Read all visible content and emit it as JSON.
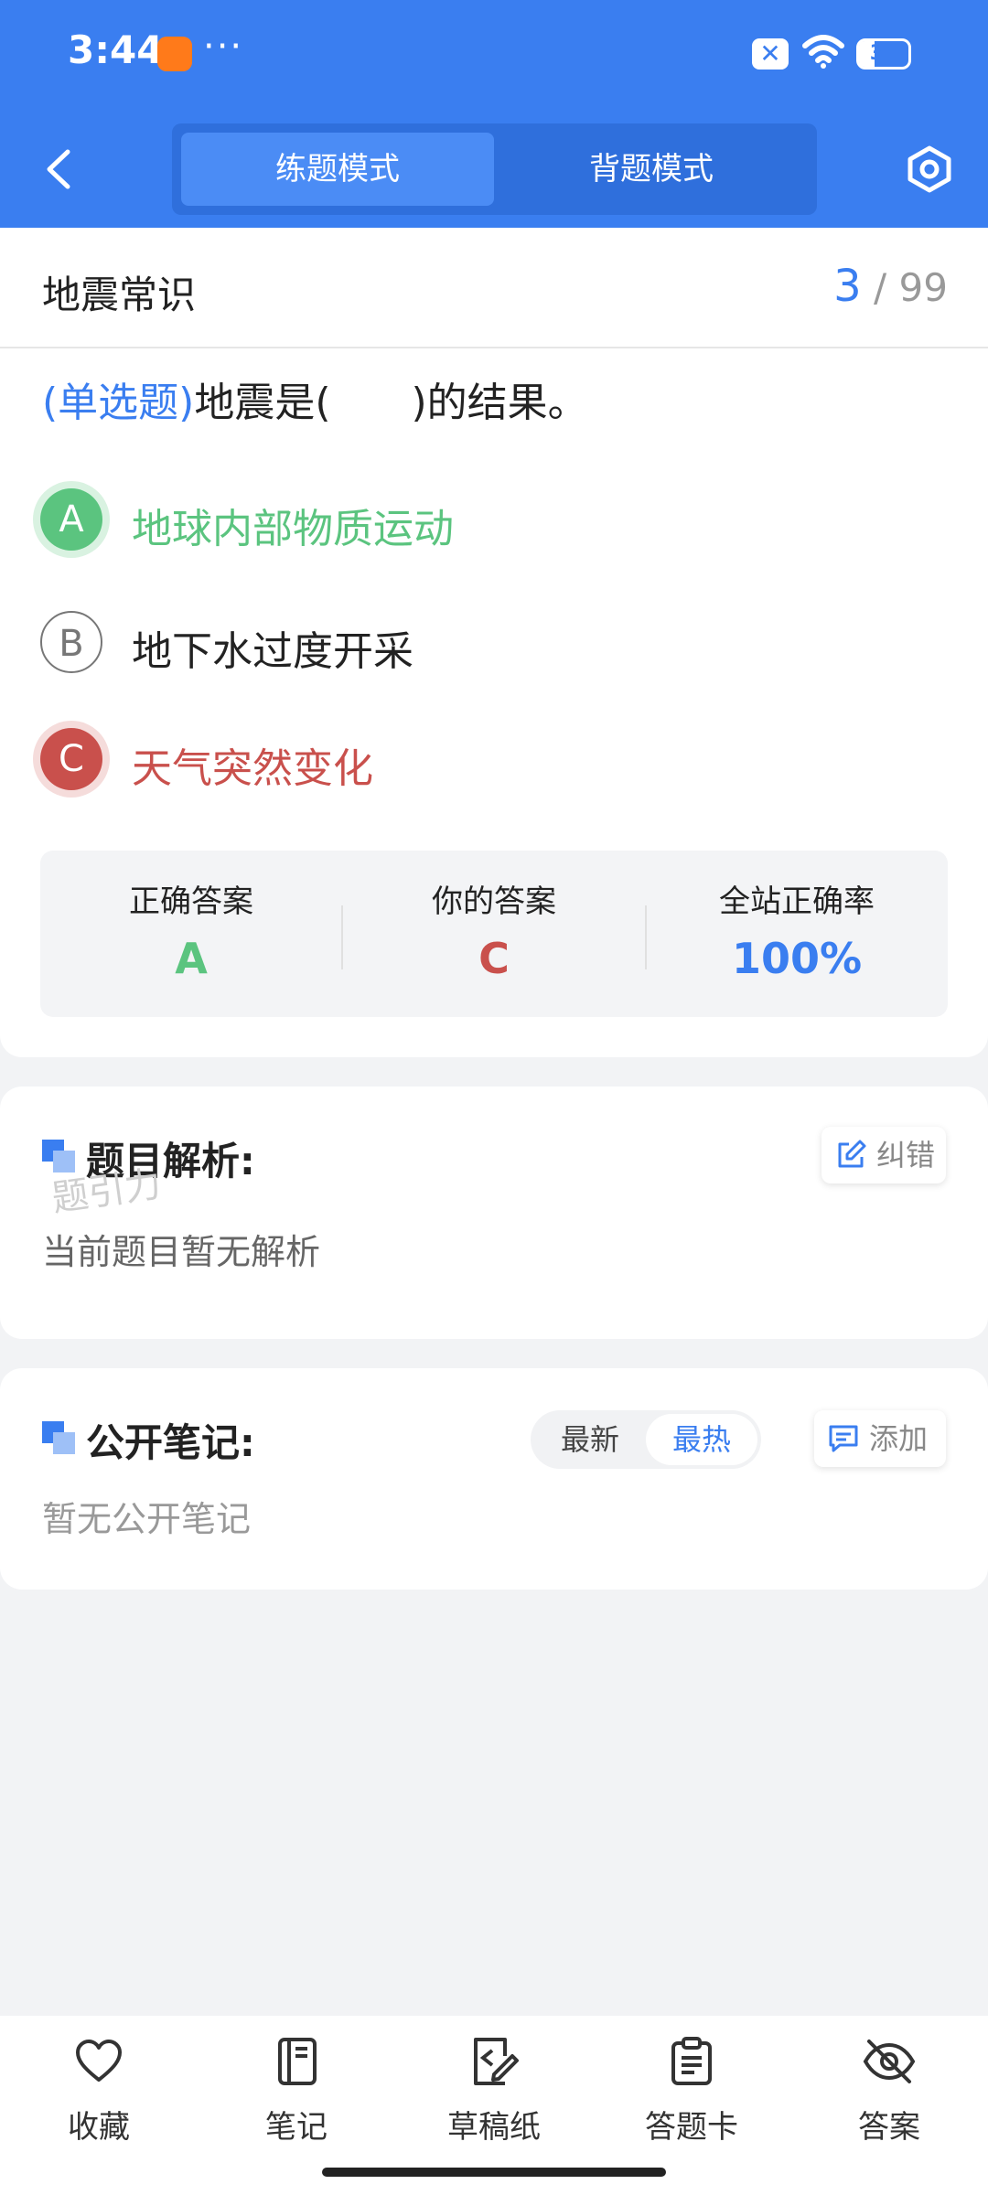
{
  "status_bar": {
    "time": "3:44",
    "dots": "···",
    "battery": "31",
    "battery_fill_percent": 31
  },
  "header": {
    "tabs": [
      {
        "label": "练题模式",
        "active": true
      },
      {
        "label": "背题模式",
        "active": false
      }
    ],
    "back_icon": "chevron-left-icon",
    "settings_icon": "hexagon-settings-icon",
    "accent_color": "#3a7ef0"
  },
  "question": {
    "category": "地震常识",
    "current": "3",
    "total_text": "/ 99",
    "type_label": "(单选题)",
    "text": "地震是(　　)的结果。",
    "options": [
      {
        "letter": "A",
        "text": "地球内部物质运动",
        "state": "correct"
      },
      {
        "letter": "B",
        "text": "地下水过度开采",
        "state": "normal"
      },
      {
        "letter": "C",
        "text": "天气突然变化",
        "state": "wrong"
      }
    ]
  },
  "stats": {
    "correct_label": "正确答案",
    "correct_value": "A",
    "yours_label": "你的答案",
    "yours_value": "C",
    "rate_label": "全站正确率",
    "rate_value": "100%",
    "colors": {
      "correct": "#5bc47f",
      "wrong": "#c9504c",
      "rate": "#3a7ef0"
    }
  },
  "analysis": {
    "title": "题目解析:",
    "correct_button": "纠错",
    "watermark": "题引力",
    "body": "当前题目暂无解析"
  },
  "notes": {
    "title": "公开笔记:",
    "sort_newest": "最新",
    "sort_hottest": "最热",
    "add_button": "添加",
    "body": "暂无公开笔记"
  },
  "bottom_nav": [
    {
      "label": "收藏",
      "icon": "heart-icon"
    },
    {
      "label": "笔记",
      "icon": "notebook-icon"
    },
    {
      "label": "草稿纸",
      "icon": "draft-paper-icon"
    },
    {
      "label": "答题卡",
      "icon": "answer-card-icon"
    },
    {
      "label": "答案",
      "icon": "eye-off-icon"
    }
  ]
}
